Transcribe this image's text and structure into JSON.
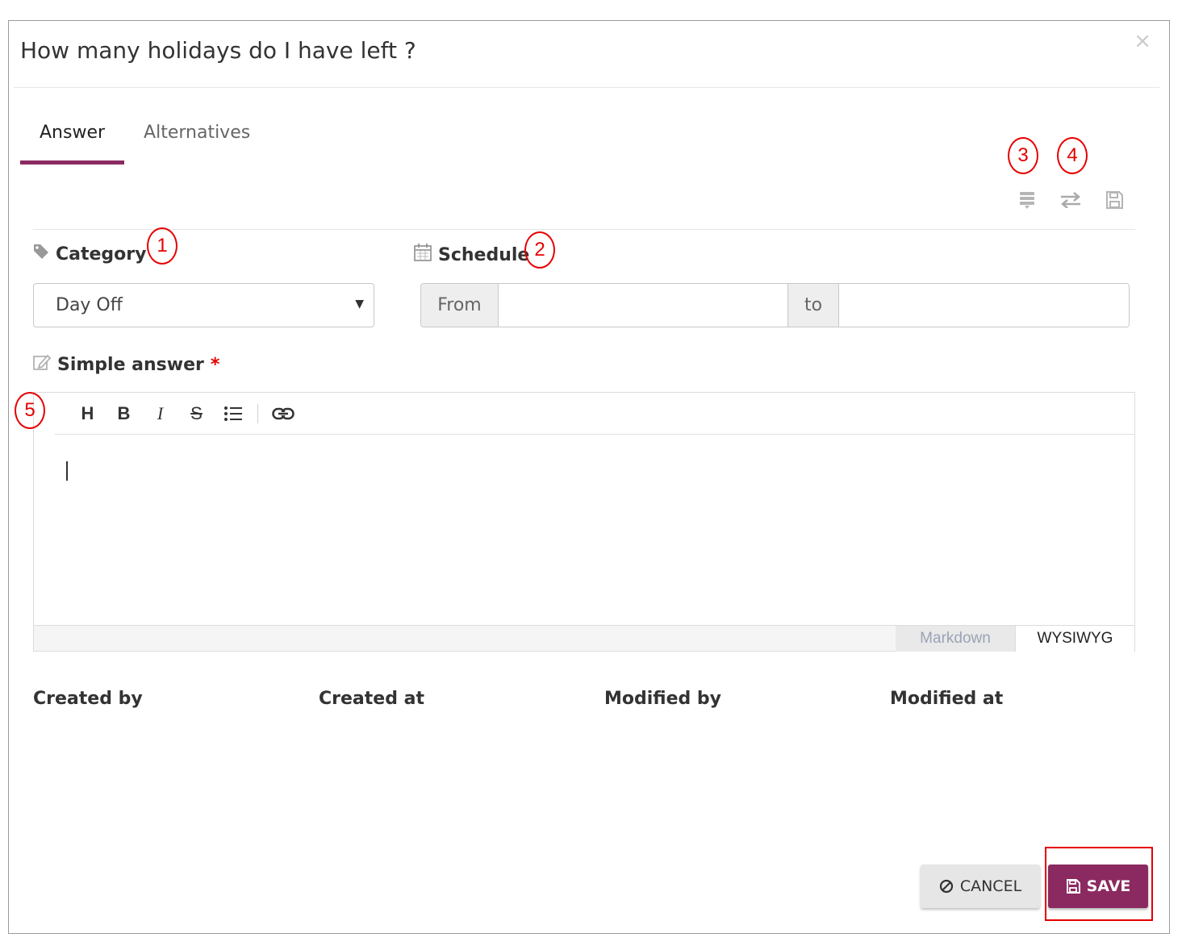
{
  "dialog": {
    "title": "How many holidays do I have left ?",
    "close_symbol": "×"
  },
  "tabs": [
    {
      "label": "Answer",
      "active": true
    },
    {
      "label": "Alternatives",
      "active": false
    }
  ],
  "toolbar_icons": [
    "stack-icon",
    "swap-arrows-icon",
    "floppy-save-icon"
  ],
  "category": {
    "label": "Category",
    "selected": "Day Off"
  },
  "schedule": {
    "label": "Schedule",
    "from_label": "From",
    "to_label": "to",
    "from_value": "",
    "to_value": ""
  },
  "simple_answer": {
    "label": "Simple answer",
    "required_mark": "*",
    "toolbar": {
      "heading": "H",
      "bold": "B",
      "italic": "I",
      "strike": "S"
    },
    "content": "",
    "modes": {
      "markdown": "Markdown",
      "wysiwyg": "WYSIWYG",
      "active": "WYSIWYG"
    }
  },
  "metadata": {
    "created_by": "Created by",
    "created_at": "Created at",
    "modified_by": "Modified by",
    "modified_at": "Modified at"
  },
  "buttons": {
    "cancel": "CANCEL",
    "save": "SAVE"
  },
  "annotations": [
    "1",
    "2",
    "3",
    "4",
    "5"
  ],
  "colors": {
    "accent": "#8b2a60",
    "annotation": "#e60000"
  }
}
